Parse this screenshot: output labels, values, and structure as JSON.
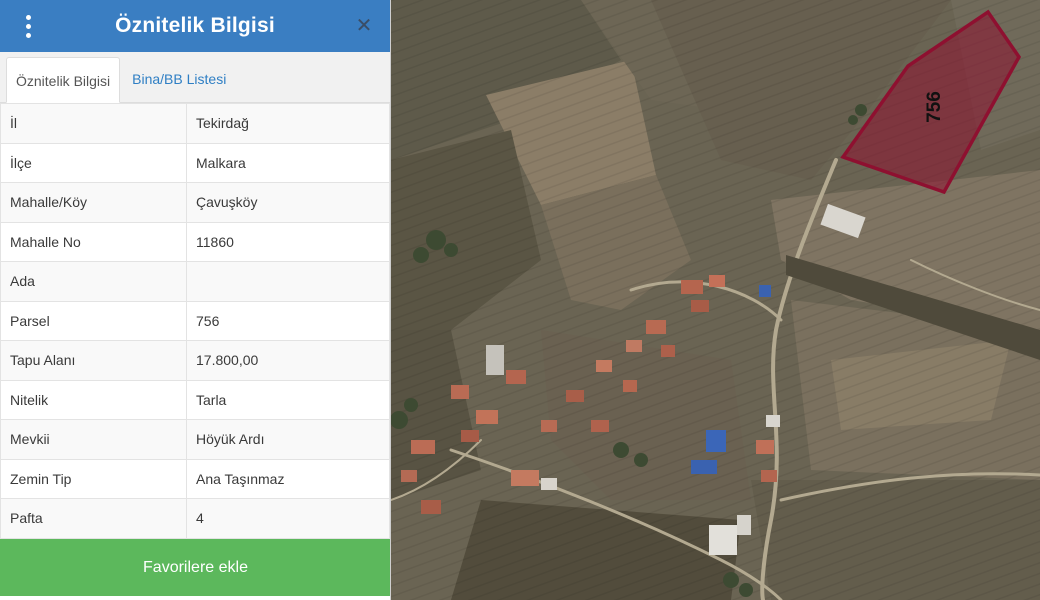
{
  "panel": {
    "title": "Öznitelik Bilgisi",
    "menu_icon": "vertical-dots-icon",
    "close_icon": "close-x-icon",
    "header_color": "#3a7ec2"
  },
  "tabs": [
    {
      "label": "Öznitelik Bilgisi",
      "active": true
    },
    {
      "label": "Bina/BB Listesi",
      "active": false
    }
  ],
  "attributes": [
    {
      "key": "İl",
      "value": "Tekirdağ"
    },
    {
      "key": "İlçe",
      "value": "Malkara"
    },
    {
      "key": "Mahalle/Köy",
      "value": "Çavuşköy"
    },
    {
      "key": "Mahalle No",
      "value": "11860"
    },
    {
      "key": "Ada",
      "value": ""
    },
    {
      "key": "Parsel",
      "value": "756"
    },
    {
      "key": "Tapu Alanı",
      "value": "17.800,00"
    },
    {
      "key": "Nitelik",
      "value": "Tarla"
    },
    {
      "key": "Mevkii",
      "value": "Höyük Ardı"
    },
    {
      "key": "Zemin Tip",
      "value": "Ana Taşınmaz"
    },
    {
      "key": "Pafta",
      "value": "4"
    }
  ],
  "favorite_button": {
    "label": "Favorilere ekle",
    "color": "#5cb85c"
  },
  "map": {
    "parcel_label": "756",
    "parcel_outline_color": "#8e1030"
  }
}
